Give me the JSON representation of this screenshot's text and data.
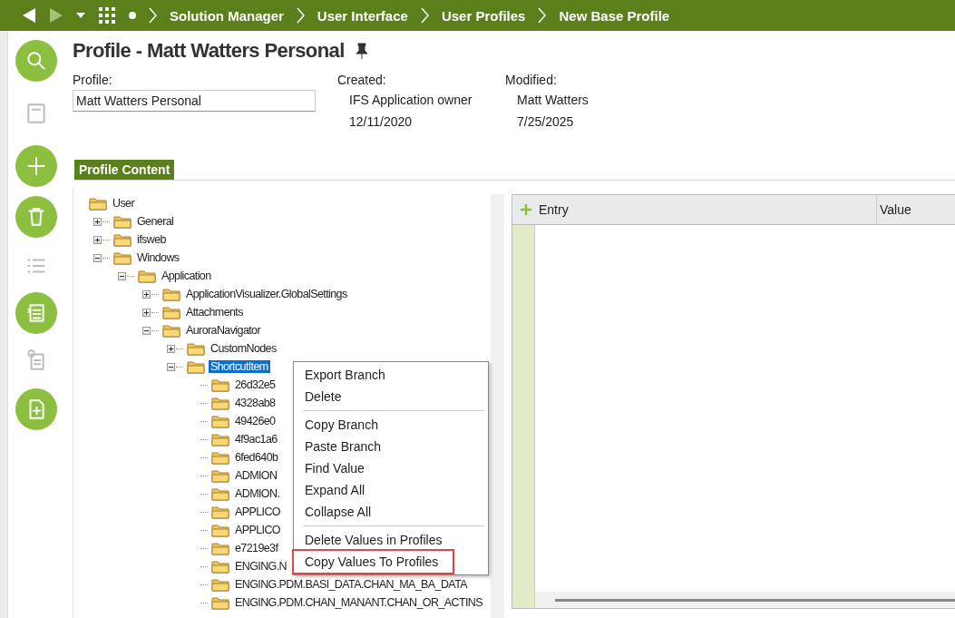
{
  "nav": {
    "breadcrumbs": [
      "Solution Manager",
      "User Interface",
      "User Profiles",
      "New Base Profile"
    ]
  },
  "header": {
    "title": "Profile - Matt Watters Personal",
    "profile_label": "Profile:",
    "profile_value": "Matt Watters Personal",
    "created_label": "Created:",
    "created_by": "IFS Application owner",
    "created_date": "12/11/2020",
    "modified_label": "Modified:",
    "modified_by": "Matt Watters",
    "modified_date": "7/25/2025"
  },
  "section_tab": "Profile Content",
  "tree": [
    {
      "label": "User",
      "selected": false,
      "children": [
        {
          "label": "General",
          "expanded": false,
          "selected": false
        },
        {
          "label": "ifsweb",
          "expanded": false,
          "selected": false
        },
        {
          "label": "Windows",
          "expanded": true,
          "selected": false,
          "children": [
            {
              "label": "Application",
              "expanded": true,
              "selected": false,
              "children": [
                {
                  "label": "ApplicationVisualizer.GlobalSettings",
                  "expanded": false,
                  "selected": false
                },
                {
                  "label": "Attachments",
                  "expanded": false,
                  "selected": false
                },
                {
                  "label": "AuroraNavigator",
                  "expanded": true,
                  "selected": false,
                  "children": [
                    {
                      "label": "CustomNodes",
                      "expanded": false,
                      "selected": false
                    },
                    {
                      "label": "ShortcutItem",
                      "expanded": true,
                      "selected": true,
                      "children": [
                        {
                          "label": "26d32e5",
                          "selected": false
                        },
                        {
                          "label": "4328ab8",
                          "selected": false
                        },
                        {
                          "label": "49426e0",
                          "selected": false
                        },
                        {
                          "label": "4f9ac1a6",
                          "selected": false
                        },
                        {
                          "label": "6fed640b",
                          "selected": false
                        },
                        {
                          "label": "ADMION",
                          "selected": false
                        },
                        {
                          "label": "ADMION.",
                          "selected": false
                        },
                        {
                          "label": "APPLICO",
                          "selected": false
                        },
                        {
                          "label": "APPLICO",
                          "selected": false
                        },
                        {
                          "label": "e7219e3f",
                          "selected": false
                        },
                        {
                          "label": "ENGING.N",
                          "selected": false
                        },
                        {
                          "label": "ENGING.PDM.BASI_DATA.CHAN_MA_BA_DATA",
                          "selected": false
                        },
                        {
                          "label": "ENGING.PDM.CHAN_MANANT.CHAN_OR_ACTINS",
                          "selected": false
                        }
                      ]
                    }
                  ]
                }
              ]
            }
          ]
        }
      ]
    }
  ],
  "context_menu": [
    [
      {
        "label": "Export Branch",
        "highlighted": false
      },
      {
        "label": "Delete",
        "highlighted": false
      }
    ],
    [
      {
        "label": "Copy Branch",
        "highlighted": false
      },
      {
        "label": "Paste Branch",
        "highlighted": false
      },
      {
        "label": "Find Value",
        "highlighted": false
      },
      {
        "label": "Expand All",
        "highlighted": false
      },
      {
        "label": "Collapse All",
        "highlighted": false
      }
    ],
    [
      {
        "label": "Delete Values in Profiles",
        "highlighted": false
      },
      {
        "label": "Copy Values To Profiles",
        "highlighted": true
      }
    ]
  ],
  "grid": {
    "columns": [
      "Entry",
      "Value"
    ]
  }
}
